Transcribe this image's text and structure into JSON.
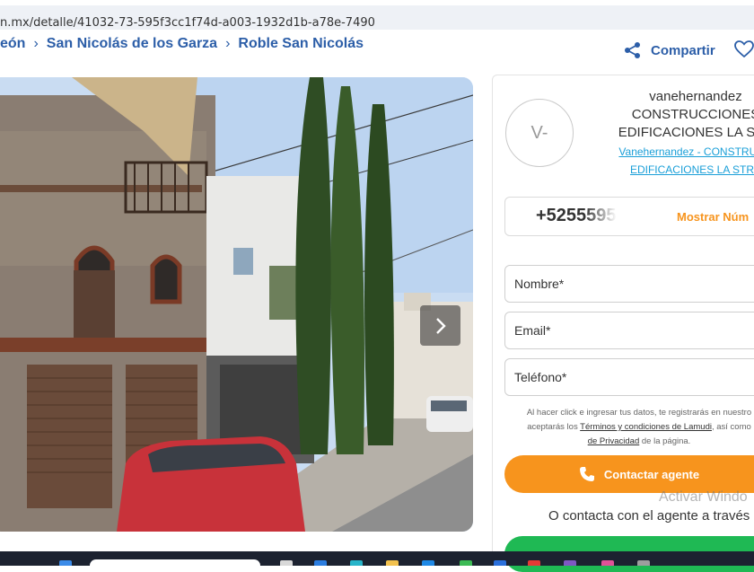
{
  "browser": {
    "url": "n.mx/detalle/41032-73-595f3cc1f74d-a003-1932d1b-a78e-7490"
  },
  "breadcrumb": {
    "items": [
      "eón",
      "San Nicolás de los Garza",
      "Roble San Nicolás"
    ]
  },
  "actions": {
    "share_label": "Compartir"
  },
  "agent": {
    "avatar_initials": "V-",
    "name_lines": [
      "vanehernandez",
      "CONSTRUCCIONES",
      "EDIFICACIONES LA STR"
    ],
    "link_lines": [
      "Vanehernandez - CONSTRUCC",
      "EDIFICACIONES LA STRA"
    ]
  },
  "phone": {
    "number": "+5255595",
    "show_label": "Mostrar Núm"
  },
  "form": {
    "name_placeholder": "Nombre*",
    "email_placeholder": "Email*",
    "phone_placeholder": "Teléfono*",
    "disclaimer": {
      "part1": "Al hacer click e ingresar tus datos, te registrarás en nuestro",
      "part2": "aceptarás los ",
      "terms_link": "Términos y condiciones de Lamudi",
      "part3": ", así como",
      "privacy_link": "de Privacidad",
      "part4": " de la página."
    },
    "submit_label": "Contactar agente",
    "alt_contact": "O contacta con el agente a través d"
  },
  "os": {
    "watermark": "Activar Windo"
  },
  "colors": {
    "accent_blue": "#2c5ea8",
    "accent_orange": "#f7941d",
    "link_blue": "#1a9fd8",
    "whatsapp_green": "#1fb954"
  },
  "icons": {
    "share": "share-icon",
    "favorite": "heart-icon",
    "next": "chevron-right-icon",
    "phone": "phone-icon"
  }
}
